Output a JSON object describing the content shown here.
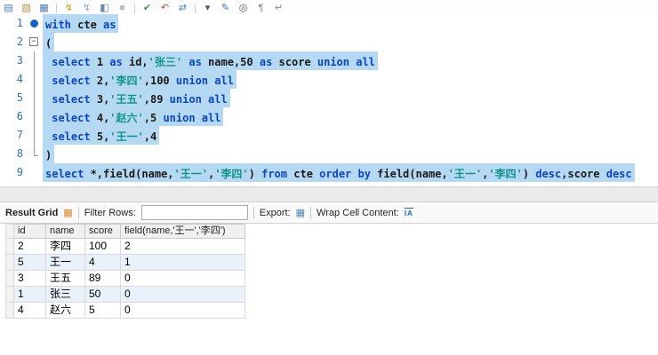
{
  "toolbar": {
    "icons": [
      {
        "name": "new-script-icon",
        "glyph": "▤",
        "color": "#4f7cb8"
      },
      {
        "name": "open-script-icon",
        "glyph": "▧",
        "color": "#b8934f"
      },
      {
        "name": "save-script-icon",
        "glyph": "▦",
        "color": "#4f7cb8"
      },
      {
        "sep": true
      },
      {
        "name": "execute-icon",
        "glyph": "↯",
        "color": "#d79b00"
      },
      {
        "name": "execute-current-statement-icon",
        "glyph": "↯",
        "color": "#8aa8c8"
      },
      {
        "name": "explain-icon",
        "glyph": "◧",
        "color": "#6a8ab0"
      },
      {
        "name": "stop-icon",
        "glyph": "■",
        "color": "#c0c0c0"
      },
      {
        "sep": true
      },
      {
        "name": "commit-icon",
        "glyph": "✔",
        "color": "#3c9a3c"
      },
      {
        "name": "rollback-icon",
        "glyph": "↶",
        "color": "#b05050"
      },
      {
        "name": "autocommit-icon",
        "glyph": "⇄",
        "color": "#4a7fb5"
      },
      {
        "sep": true
      },
      {
        "name": "limit-rows-icon",
        "glyph": "▾",
        "color": "#555555"
      },
      {
        "name": "beautify-icon",
        "glyph": "✎",
        "color": "#3f6fb0"
      },
      {
        "name": "find-icon",
        "glyph": "◎",
        "color": "#555555"
      },
      {
        "name": "special-chars-icon",
        "glyph": "¶",
        "color": "#888888"
      },
      {
        "name": "wrap-text-icon",
        "glyph": "↵",
        "color": "#888888"
      }
    ]
  },
  "editor": {
    "selection_color": "#b5d9f2",
    "lines": [
      {
        "num": "1",
        "marker": "breakpoint",
        "selected": true,
        "segments": [
          {
            "c": "k",
            "t": "with"
          },
          {
            "c": "p",
            "t": " cte "
          },
          {
            "c": "k",
            "t": "as"
          }
        ]
      },
      {
        "num": "2",
        "marker": "fold",
        "selected": true,
        "segments": [
          {
            "c": "p",
            "t": "("
          }
        ]
      },
      {
        "num": "3",
        "marker": "foldline",
        "selected": true,
        "segments": [
          {
            "c": "p",
            "t": " "
          },
          {
            "c": "k",
            "t": "select"
          },
          {
            "c": "p",
            "t": " "
          },
          {
            "c": "n",
            "t": "1"
          },
          {
            "c": "p",
            "t": " "
          },
          {
            "c": "k",
            "t": "as"
          },
          {
            "c": "p",
            "t": " id,"
          },
          {
            "c": "s",
            "t": "'张三'"
          },
          {
            "c": "p",
            "t": " "
          },
          {
            "c": "k",
            "t": "as"
          },
          {
            "c": "p",
            "t": " name,"
          },
          {
            "c": "n",
            "t": "50"
          },
          {
            "c": "p",
            "t": " "
          },
          {
            "c": "k",
            "t": "as"
          },
          {
            "c": "p",
            "t": " score "
          },
          {
            "c": "k",
            "t": "union all"
          }
        ]
      },
      {
        "num": "4",
        "marker": "foldline",
        "selected": true,
        "segments": [
          {
            "c": "p",
            "t": " "
          },
          {
            "c": "k",
            "t": "select"
          },
          {
            "c": "p",
            "t": " "
          },
          {
            "c": "n",
            "t": "2"
          },
          {
            "c": "p",
            "t": ","
          },
          {
            "c": "s",
            "t": "'李四'"
          },
          {
            "c": "p",
            "t": ","
          },
          {
            "c": "n",
            "t": "100"
          },
          {
            "c": "p",
            "t": " "
          },
          {
            "c": "k",
            "t": "union all"
          }
        ]
      },
      {
        "num": "5",
        "marker": "foldline",
        "selected": true,
        "segments": [
          {
            "c": "p",
            "t": " "
          },
          {
            "c": "k",
            "t": "select"
          },
          {
            "c": "p",
            "t": " "
          },
          {
            "c": "n",
            "t": "3"
          },
          {
            "c": "p",
            "t": ","
          },
          {
            "c": "s",
            "t": "'王五'"
          },
          {
            "c": "p",
            "t": ","
          },
          {
            "c": "n",
            "t": "89"
          },
          {
            "c": "p",
            "t": " "
          },
          {
            "c": "k",
            "t": "union all"
          }
        ]
      },
      {
        "num": "6",
        "marker": "foldline",
        "selected": true,
        "segments": [
          {
            "c": "p",
            "t": " "
          },
          {
            "c": "k",
            "t": "select"
          },
          {
            "c": "p",
            "t": " "
          },
          {
            "c": "n",
            "t": "4"
          },
          {
            "c": "p",
            "t": ","
          },
          {
            "c": "s",
            "t": "'赵六'"
          },
          {
            "c": "p",
            "t": ","
          },
          {
            "c": "n",
            "t": "5"
          },
          {
            "c": "p",
            "t": " "
          },
          {
            "c": "k",
            "t": "union all"
          }
        ]
      },
      {
        "num": "7",
        "marker": "foldline",
        "selected": true,
        "segments": [
          {
            "c": "p",
            "t": " "
          },
          {
            "c": "k",
            "t": "select"
          },
          {
            "c": "p",
            "t": " "
          },
          {
            "c": "n",
            "t": "5"
          },
          {
            "c": "p",
            "t": ","
          },
          {
            "c": "s",
            "t": "'王一'"
          },
          {
            "c": "p",
            "t": ","
          },
          {
            "c": "n",
            "t": "4"
          }
        ]
      },
      {
        "num": "8",
        "marker": "foldend",
        "selected": true,
        "segments": [
          {
            "c": "p",
            "t": ")"
          }
        ]
      },
      {
        "num": "9",
        "marker": "none",
        "selected": true,
        "segments": [
          {
            "c": "k",
            "t": "select"
          },
          {
            "c": "p",
            "t": " *,field(name,"
          },
          {
            "c": "s",
            "t": "'王一'"
          },
          {
            "c": "p",
            "t": ","
          },
          {
            "c": "s",
            "t": "'李四'"
          },
          {
            "c": "p",
            "t": ") "
          },
          {
            "c": "k",
            "t": "from"
          },
          {
            "c": "p",
            "t": " cte "
          },
          {
            "c": "k",
            "t": "order by"
          },
          {
            "c": "p",
            "t": " field(name,"
          },
          {
            "c": "s",
            "t": "'王一'"
          },
          {
            "c": "p",
            "t": ","
          },
          {
            "c": "s",
            "t": "'李四'"
          },
          {
            "c": "p",
            "t": ") "
          },
          {
            "c": "k",
            "t": "desc"
          },
          {
            "c": "p",
            "t": ",score "
          },
          {
            "c": "k",
            "t": "desc"
          }
        ]
      }
    ]
  },
  "result_toolbar": {
    "result_grid_label": "Result Grid",
    "filter_rows_label": "Filter Rows:",
    "filter_value": "",
    "export_label": "Export:",
    "wrap_label": "Wrap Cell Content:",
    "wrap_icon_text": "IA"
  },
  "grid": {
    "stripe_color": "#e9f2fb",
    "columns": [
      "id",
      "name",
      "score",
      "field(name,'王一','李四')"
    ],
    "rows": [
      [
        "2",
        "李四",
        "100",
        "2"
      ],
      [
        "5",
        "王一",
        "4",
        "1"
      ],
      [
        "3",
        "王五",
        "89",
        "0"
      ],
      [
        "1",
        "张三",
        "50",
        "0"
      ],
      [
        "4",
        "赵六",
        "5",
        "0"
      ]
    ]
  }
}
